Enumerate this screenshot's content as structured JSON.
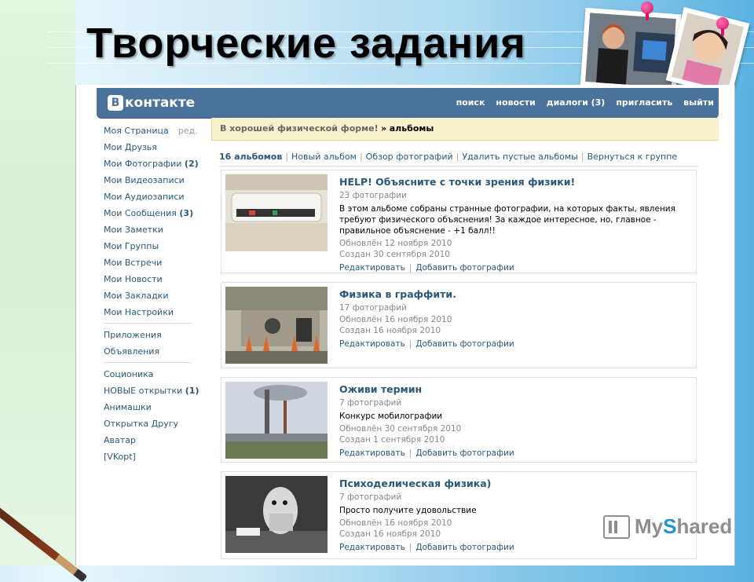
{
  "slide": {
    "title": "Творческие задания"
  },
  "vk": {
    "logo": "контакте",
    "logo_letter": "B",
    "nav": [
      "поиск",
      "новости",
      "диалоги (3)",
      "пригласить",
      "выйти"
    ]
  },
  "sidebar": {
    "group1": [
      {
        "label": "Моя Страница",
        "extra": "ред."
      },
      {
        "label": "Мои Друзья"
      },
      {
        "label": "Мои Фотографии",
        "count": "(2)"
      },
      {
        "label": "Мои Видеозаписи"
      },
      {
        "label": "Мои Аудиозаписи"
      },
      {
        "label": "Мои Сообщения",
        "count": "(3)"
      },
      {
        "label": "Мои Заметки"
      },
      {
        "label": "Мои Группы"
      },
      {
        "label": "Мои Встречи"
      },
      {
        "label": "Мои Новости"
      },
      {
        "label": "Мои Закладки"
      },
      {
        "label": "Мои Настройки"
      }
    ],
    "group2": [
      {
        "label": "Приложения"
      },
      {
        "label": "Объявления"
      }
    ],
    "group3": [
      {
        "label": "Соционика"
      },
      {
        "label": "НОВЫЕ открытки",
        "count": "(1)"
      },
      {
        "label": "Анимашки"
      },
      {
        "label": "Открытка Другу"
      },
      {
        "label": "Аватар"
      },
      {
        "label": "[VKopt]"
      }
    ]
  },
  "breadcrumb": {
    "group": "В хорошей физической форме!",
    "arrow": "»",
    "current": "альбомы"
  },
  "tabs": [
    "16 альбомов",
    "Новый альбом",
    "Обзор фотографий",
    "Удалить пустые альбомы",
    "Вернуться к группе"
  ],
  "albums": [
    {
      "title": "HELP! Объясните с точки зрения физики!",
      "count": "23 фотографии",
      "description": "В этом альбоме собраны странные фотографии, на которых факты, явления требуют физического объяснения! За каждое интересное, но, главное - правильное объяснение - +1 балл!!",
      "updated": "Обновлён 12 ноября 2010",
      "created": "Создан 30 сентября 2010",
      "edit": "Редактировать",
      "add": "Добавить фотографии"
    },
    {
      "title": "Физика в граффити.",
      "count": "17 фотографий",
      "description": "",
      "updated": "Обновлён 16 ноября 2010",
      "created": "Создан 16 ноября 2010",
      "edit": "Редактировать",
      "add": "Добавить фотографии"
    },
    {
      "title": "Оживи термин",
      "count": "7 фотографий",
      "description": "Конкурс мобилографии",
      "updated": "Обновлён 30 сентября 2010",
      "created": "Создан 1 сентября 2010",
      "edit": "Редактировать",
      "add": "Добавить фотографии"
    },
    {
      "title": "Психоделическая физика)",
      "count": "7 фотографий",
      "description": "Просто получите удовольствие",
      "updated": "Обновлён 16 ноября 2010",
      "created": "Создан 16 ноября 2010",
      "edit": "Редактировать",
      "add": "Добавить фотографии"
    }
  ],
  "watermark": {
    "prefix": "My",
    "accent": "S",
    "suffix": "hared"
  },
  "colors": {
    "vk_header": "#4a729b",
    "link": "#2b587a",
    "crumb_bg": "#f7f1cc"
  }
}
